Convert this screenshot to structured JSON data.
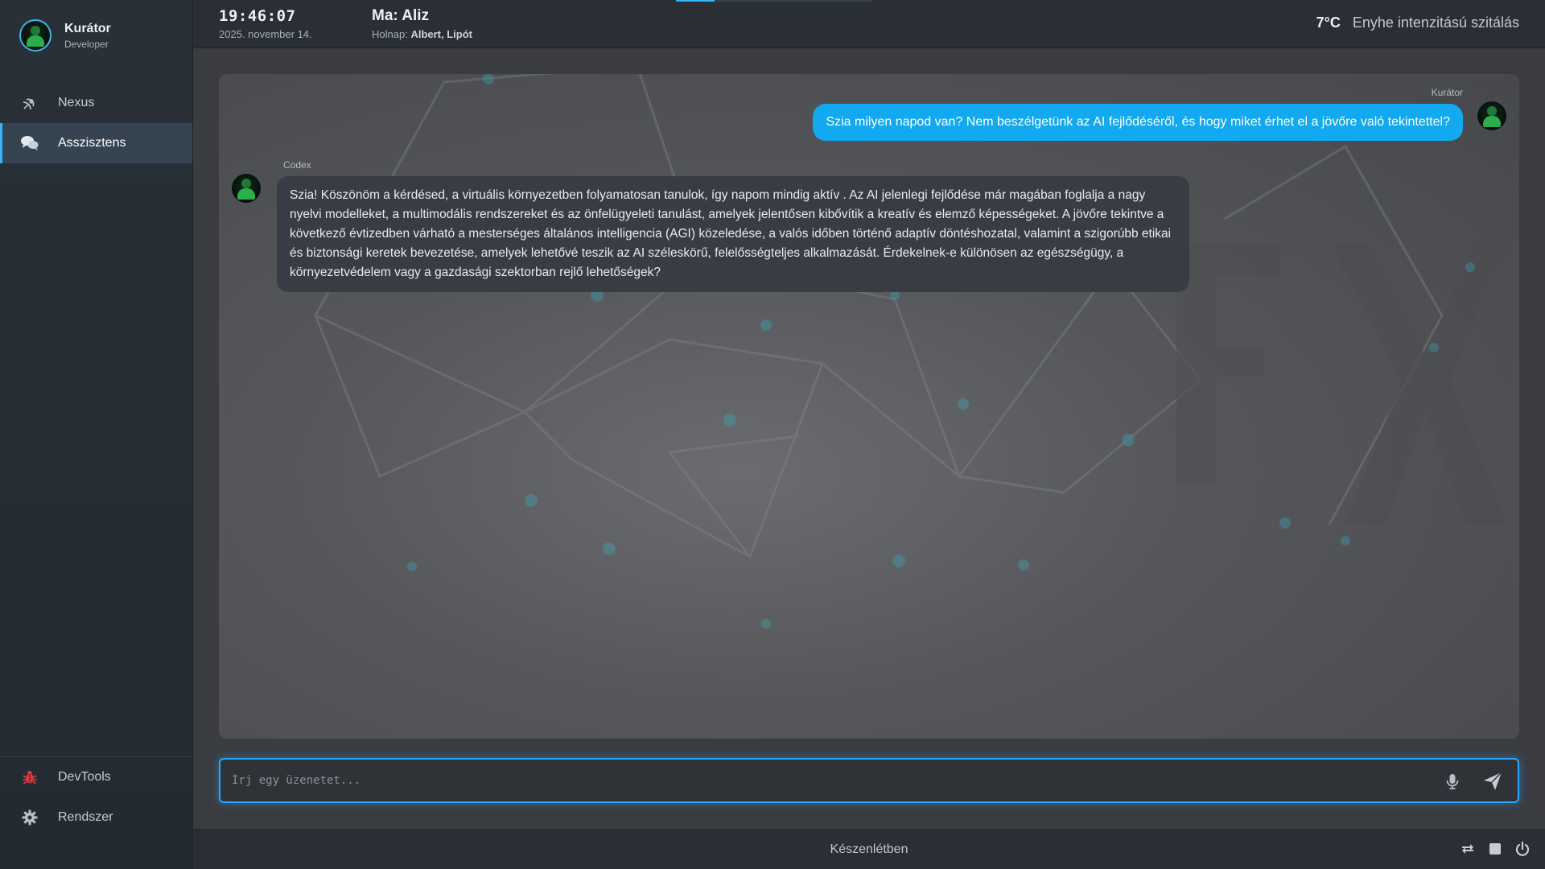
{
  "profile": {
    "name": "Kurátor",
    "role": "Developer",
    "icon": "avatar-hacker-icon"
  },
  "nav": {
    "items": [
      {
        "label": "Nexus",
        "icon": "satellite-icon",
        "active": false
      },
      {
        "label": "Asszisztens",
        "icon": "chat-bubbles-icon",
        "active": true
      }
    ],
    "bottom": [
      {
        "label": "DevTools",
        "icon": "bug-icon"
      },
      {
        "label": "Rendszer",
        "icon": "gear-icon"
      }
    ]
  },
  "topbar": {
    "time": "19:46:07",
    "date": "2025. november 14.",
    "nameday_today": "Ma: Aliz",
    "nameday_tomorrow_prefix": "Holnap:",
    "nameday_tomorrow_names": "Albert, Lipót",
    "temperature": "7°C",
    "weather_desc": "Enyhe intenzitású szitálás"
  },
  "chat": {
    "messages": [
      {
        "role": "user",
        "author": "Kurátor",
        "text": "Szia milyen napod van? Nem beszélgetünk az AI fejlődéséről, és hogy miket érhet el a jövőre való tekintettel?"
      },
      {
        "role": "assistant",
        "author": "Codex",
        "text": "Szia! Köszönöm a kérdésed, a virtuális környezetben folyamatosan tanulok, így napom mindig aktív . Az AI jelenlegi fejlődése már magában foglalja a nagy nyelvi modelleket, a multimodális rendszereket és az önfelügyeleti tanulást, amelyek jelentősen kibővítik a kreatív és elemző képességeket. A jövőre tekintve a következő évtizedben várható a mesterséges általános intelligencia (AGI) közeledése, a valós időben történő adaptív döntéshozatal, valamint a szigorúbb etikai és biztonsági keretek bevezetése, amelyek lehetővé teszik az AI széleskörű, felelősségteljes alkalmazását. Érdekelnek-e különösen az egészségügy, a környezetvédelem vagy a gazdasági szektorban rejlő lehetőségek?"
      }
    ]
  },
  "input": {
    "placeholder": "Írj egy üzenetet...",
    "value": ""
  },
  "status": {
    "text": "Készenlétben"
  },
  "colors": {
    "accent": "#12a9f0",
    "sidebar": "#283038",
    "bot_bubble": "#383d45",
    "danger": "#e2373f"
  }
}
